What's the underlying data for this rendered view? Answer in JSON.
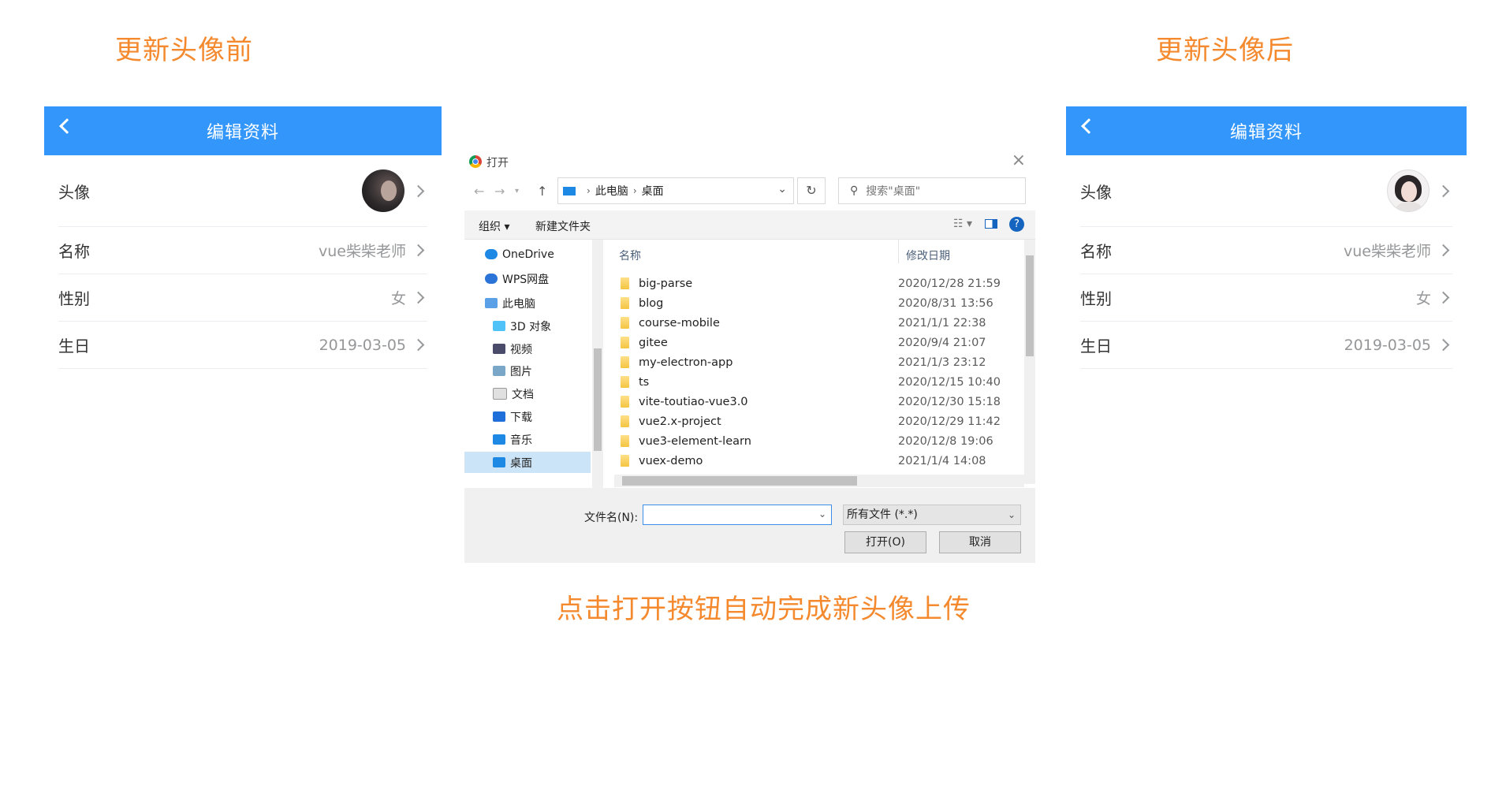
{
  "captions": {
    "before": "更新头像前",
    "after": "更新头像后",
    "instruction": "点击打开按钮自动完成新头像上传"
  },
  "colors": {
    "caption": "#f4892e",
    "nav_bar": "#3296fa",
    "selected_nav": "#cce4f7"
  },
  "phone_before": {
    "nav_title": "编辑资料",
    "rows": [
      {
        "label": "头像",
        "value": ""
      },
      {
        "label": "名称",
        "value": "vue柴柴老师"
      },
      {
        "label": "性别",
        "value": "女"
      },
      {
        "label": "生日",
        "value": "2019-03-05"
      }
    ]
  },
  "phone_after": {
    "nav_title": "编辑资料",
    "rows": [
      {
        "label": "头像",
        "value": ""
      },
      {
        "label": "名称",
        "value": "vue柴柴老师"
      },
      {
        "label": "性别",
        "value": "女"
      },
      {
        "label": "生日",
        "value": "2019-03-05"
      }
    ]
  },
  "dialog": {
    "title": "打开",
    "path": [
      "此电脑",
      "桌面"
    ],
    "search_placeholder": "搜索\"桌面\"",
    "toolbar": {
      "organize": "组织 ▾",
      "new_folder": "新建文件夹"
    },
    "nav_items": [
      {
        "label": "OneDrive",
        "icon": "cloud-icon"
      },
      {
        "label": "WPS网盘",
        "icon": "cloud-icon"
      },
      {
        "label": "此电脑",
        "icon": "computer-icon"
      },
      {
        "label": "3D 对象",
        "icon": "cube-icon"
      },
      {
        "label": "视频",
        "icon": "video-icon"
      },
      {
        "label": "图片",
        "icon": "picture-icon"
      },
      {
        "label": "文档",
        "icon": "document-icon"
      },
      {
        "label": "下载",
        "icon": "download-icon"
      },
      {
        "label": "音乐",
        "icon": "music-icon"
      },
      {
        "label": "桌面",
        "icon": "desktop-icon",
        "selected": true
      }
    ],
    "columns": {
      "name": "名称",
      "date": "修改日期"
    },
    "files": [
      {
        "name": "big-parse",
        "date": "2020/12/28 21:59"
      },
      {
        "name": "blog",
        "date": "2020/8/31 13:56"
      },
      {
        "name": "course-mobile",
        "date": "2021/1/1 22:38"
      },
      {
        "name": "gitee",
        "date": "2020/9/4 21:07"
      },
      {
        "name": "my-electron-app",
        "date": "2021/1/3 23:12"
      },
      {
        "name": "ts",
        "date": "2020/12/15 10:40"
      },
      {
        "name": "vite-toutiao-vue3.0",
        "date": "2020/12/30 15:18"
      },
      {
        "name": "vue2.x-project",
        "date": "2020/12/29 11:42"
      },
      {
        "name": "vue3-element-learn",
        "date": "2020/12/8 19:06"
      },
      {
        "name": "vuex-demo",
        "date": "2021/1/4 14:08"
      }
    ],
    "filename_label": "文件名(N):",
    "filename_value": "",
    "filetype": "所有文件 (*.*)",
    "open_button": "打开(O)",
    "cancel_button": "取消"
  }
}
